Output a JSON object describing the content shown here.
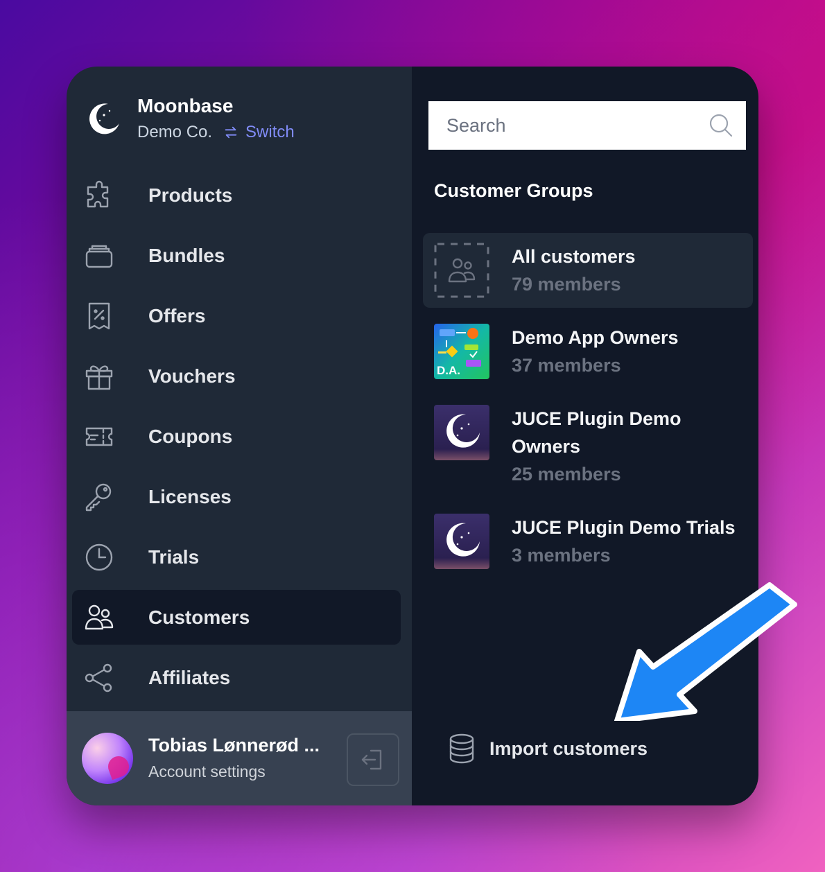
{
  "brand": {
    "name": "Moonbase",
    "org": "Demo Co.",
    "switch_label": "Switch"
  },
  "nav": [
    {
      "label": "Products",
      "icon": "puzzle-icon"
    },
    {
      "label": "Bundles",
      "icon": "box-stack-icon"
    },
    {
      "label": "Offers",
      "icon": "receipt-percent-icon"
    },
    {
      "label": "Vouchers",
      "icon": "gift-icon"
    },
    {
      "label": "Coupons",
      "icon": "ticket-icon"
    },
    {
      "label": "Licenses",
      "icon": "key-icon"
    },
    {
      "label": "Trials",
      "icon": "clock-icon"
    },
    {
      "label": "Customers",
      "icon": "users-icon",
      "active": true
    },
    {
      "label": "Affiliates",
      "icon": "share-icon"
    }
  ],
  "account": {
    "name": "Tobias Lønnerød ...",
    "link": "Account settings"
  },
  "search": {
    "placeholder": "Search"
  },
  "groups_title": "Customer Groups",
  "groups": [
    {
      "name": "All customers",
      "count": "79 members",
      "active": true
    },
    {
      "name": "Demo App Owners",
      "count": "37 members",
      "thumb_text": "D.A."
    },
    {
      "name": "JUCE Plugin Demo Owners",
      "count": "25 members"
    },
    {
      "name": "JUCE Plugin Demo Trials",
      "count": "3 members"
    }
  ],
  "import_label": "Import customers",
  "colors": {
    "sidebar": "#1f2937",
    "panel": "#111827",
    "accent": "#818cf8",
    "arrow": "#1d86f5"
  }
}
